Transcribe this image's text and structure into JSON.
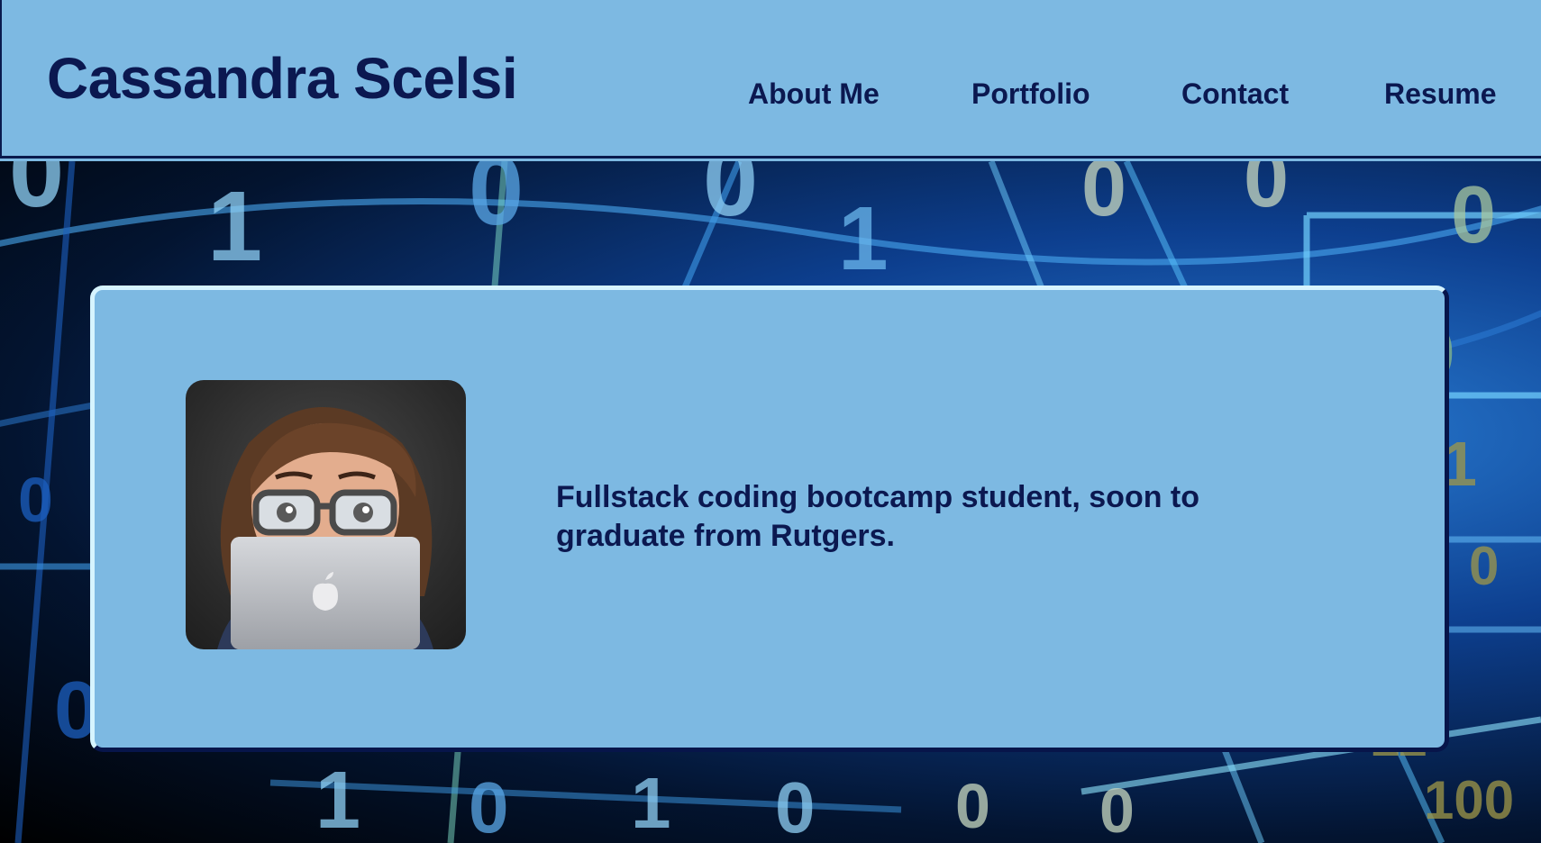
{
  "header": {
    "title": "Cassandra Scelsi",
    "nav": [
      {
        "label": "About Me"
      },
      {
        "label": "Portfolio"
      },
      {
        "label": "Contact"
      },
      {
        "label": "Resume"
      }
    ]
  },
  "hero": {
    "avatar_icon": "memoji-avatar-with-laptop",
    "tagline": "Fullstack coding bootcamp student, soon to graduate from Rutgers."
  },
  "colors": {
    "background": "#7db9e2",
    "text": "#0b1850",
    "border_dark": "#07154a",
    "border_light": "#d6f4ff"
  }
}
